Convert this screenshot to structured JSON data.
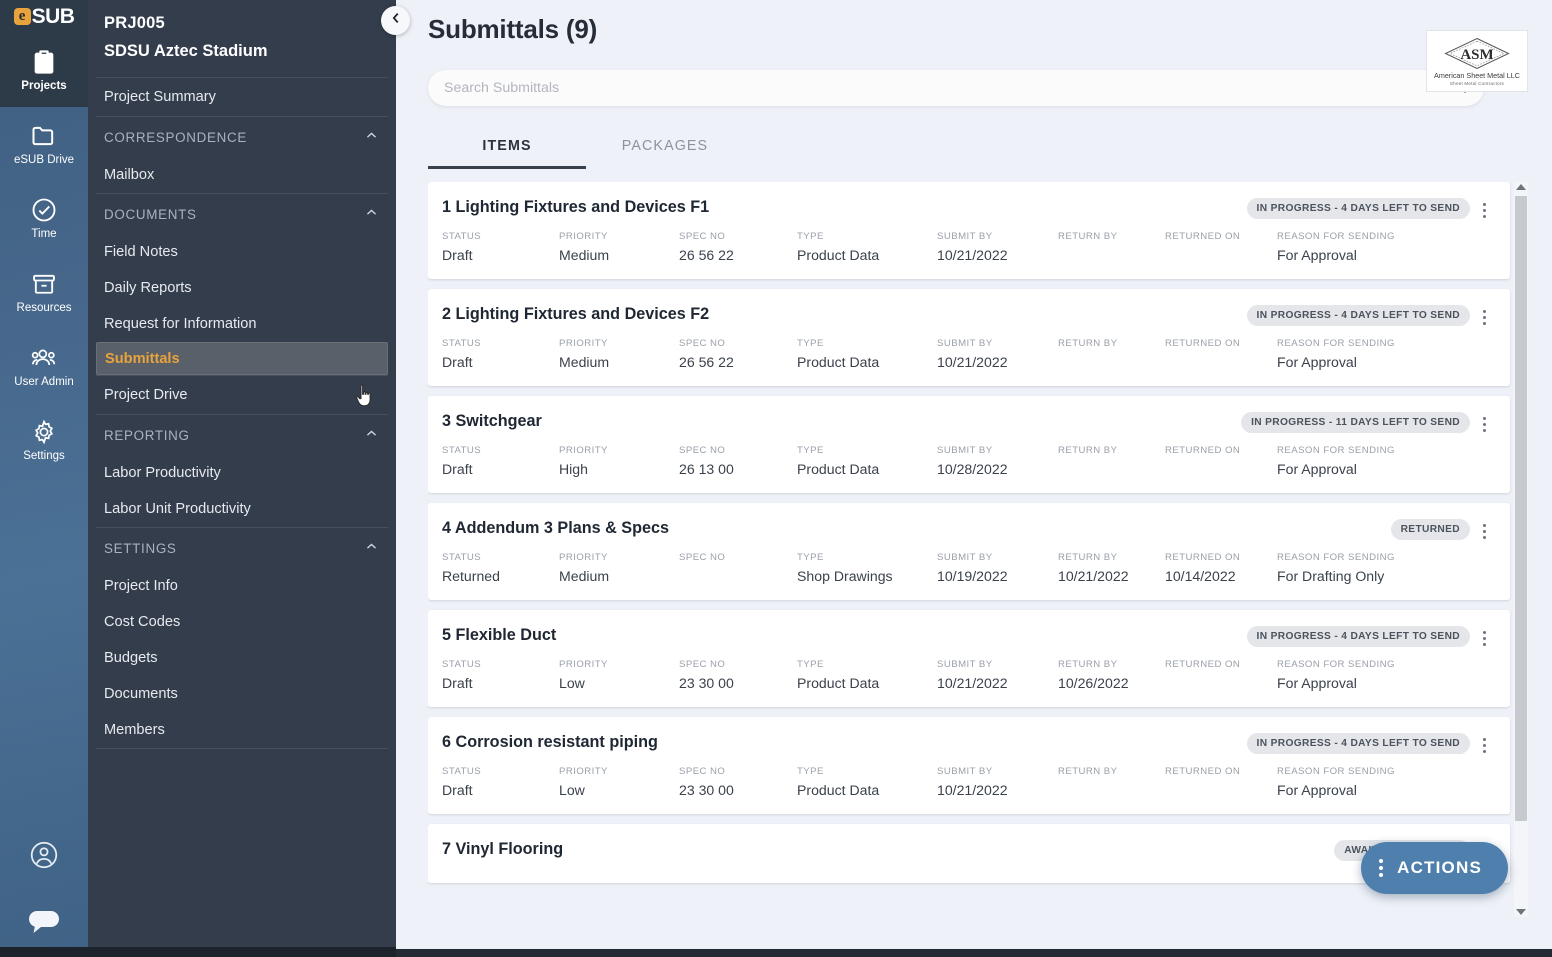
{
  "brand": {
    "logo_e": "e",
    "logo_text": "SUB"
  },
  "rail": {
    "items": [
      {
        "label": "Projects",
        "icon": "clipboard-icon",
        "active": true
      },
      {
        "label": "eSUB Drive",
        "icon": "folder-icon",
        "active": false
      },
      {
        "label": "Time",
        "icon": "clock-icon",
        "active": false
      },
      {
        "label": "Resources",
        "icon": "box-icon",
        "active": false
      },
      {
        "label": "User Admin",
        "icon": "people-icon",
        "active": false
      },
      {
        "label": "Settings",
        "icon": "gear-icon",
        "active": false
      }
    ],
    "bottom": [
      {
        "icon": "account-circle-icon"
      },
      {
        "icon": "chat-bubble-icon"
      }
    ]
  },
  "nav": {
    "project_number": "PRJ005",
    "project_name": "SDSU Aztec Stadium",
    "summary_label": "Project Summary",
    "groups": [
      {
        "title": "CORRESPONDENCE",
        "expanded": true,
        "items": [
          {
            "label": "Mailbox",
            "selected": false
          }
        ]
      },
      {
        "title": "DOCUMENTS",
        "expanded": true,
        "items": [
          {
            "label": "Field Notes",
            "selected": false
          },
          {
            "label": "Daily Reports",
            "selected": false
          },
          {
            "label": "Request for Information",
            "selected": false
          },
          {
            "label": "Submittals",
            "selected": true
          }
        ]
      }
    ],
    "project_drive_label": "Project Drive",
    "groups2": [
      {
        "title": "REPORTING",
        "expanded": true,
        "items": [
          {
            "label": "Labor Productivity",
            "selected": false
          },
          {
            "label": "Labor Unit Productivity",
            "selected": false
          }
        ]
      },
      {
        "title": "SETTINGS",
        "expanded": true,
        "items": [
          {
            "label": "Project Info",
            "selected": false
          },
          {
            "label": "Cost Codes",
            "selected": false
          },
          {
            "label": "Budgets",
            "selected": false
          },
          {
            "label": "Documents",
            "selected": false
          },
          {
            "label": "Members",
            "selected": false
          }
        ]
      }
    ],
    "collapse_icon": "chevron-left-icon"
  },
  "header": {
    "title": "Submittals (9)",
    "company_logo": {
      "mark": "ASM",
      "line1": "American Sheet Metal LLC",
      "line2": "Sheet Metal Contractors"
    }
  },
  "search": {
    "placeholder": "Search Submittals",
    "value": "",
    "search_icon": "search-icon",
    "sort_icon": "sort-filter-icon"
  },
  "tabs": [
    {
      "label": "ITEMS",
      "active": true
    },
    {
      "label": "PACKAGES",
      "active": false
    }
  ],
  "columns": {
    "status": "STATUS",
    "priority": "PRIORITY",
    "spec_no": "SPEC NO",
    "type": "TYPE",
    "submit_by": "SUBMIT BY",
    "return_by": "RETURN BY",
    "returned_on": "RETURNED ON",
    "reason": "REASON FOR SENDING"
  },
  "items": [
    {
      "title": "1 Lighting Fixtures and Devices F1",
      "badge": "IN PROGRESS - 4 DAYS LEFT TO SEND",
      "status": "Draft",
      "priority": "Medium",
      "spec_no": "26 56 22",
      "type": "Product Data",
      "submit_by": "10/21/2022",
      "return_by": "",
      "returned_on": "",
      "reason": "For Approval"
    },
    {
      "title": "2 Lighting Fixtures and Devices F2",
      "badge": "IN PROGRESS - 4 DAYS LEFT TO SEND",
      "status": "Draft",
      "priority": "Medium",
      "spec_no": "26 56 22",
      "type": "Product Data",
      "submit_by": "10/21/2022",
      "return_by": "",
      "returned_on": "",
      "reason": "For Approval"
    },
    {
      "title": "3 Switchgear",
      "badge": "IN PROGRESS - 11 DAYS LEFT TO SEND",
      "status": "Draft",
      "priority": "High",
      "spec_no": "26 13 00",
      "type": "Product Data",
      "submit_by": "10/28/2022",
      "return_by": "",
      "returned_on": "",
      "reason": "For Approval"
    },
    {
      "title": "4 Addendum 3 Plans & Specs",
      "badge": "RETURNED",
      "status": "Returned",
      "priority": "Medium",
      "spec_no": "",
      "type": "Shop Drawings",
      "submit_by": "10/19/2022",
      "return_by": "10/21/2022",
      "returned_on": "10/14/2022",
      "reason": "For Drafting Only"
    },
    {
      "title": "5 Flexible Duct",
      "badge": "IN PROGRESS - 4 DAYS LEFT TO SEND",
      "status": "Draft",
      "priority": "Low",
      "spec_no": "23 30 00",
      "type": "Product Data",
      "submit_by": "10/21/2022",
      "return_by": "10/26/2022",
      "returned_on": "",
      "reason": "For Approval"
    },
    {
      "title": "6 Corrosion resistant piping",
      "badge": "IN PROGRESS - 4 DAYS LEFT TO SEND",
      "status": "Draft",
      "priority": "Low",
      "spec_no": "23 30 00",
      "type": "Product Data",
      "submit_by": "10/21/2022",
      "return_by": "",
      "returned_on": "",
      "reason": "For Approval"
    },
    {
      "title": "7 Vinyl Flooring",
      "badge": "AWAITING RESPONSE",
      "status": "",
      "priority": "",
      "spec_no": "",
      "type": "",
      "submit_by": "",
      "return_by": "",
      "returned_on": "",
      "reason": ""
    }
  ],
  "fab": {
    "label": "ACTIONS",
    "icon": "vertical-dots-icon"
  },
  "colors": {
    "accent_orange": "#e8a33d",
    "rail_blue": "#47688c",
    "nav_dark": "#333d4c",
    "fab_blue": "#4f80ad",
    "badge_gray": "#e4e6ea",
    "page_bg": "#eef1f7"
  }
}
